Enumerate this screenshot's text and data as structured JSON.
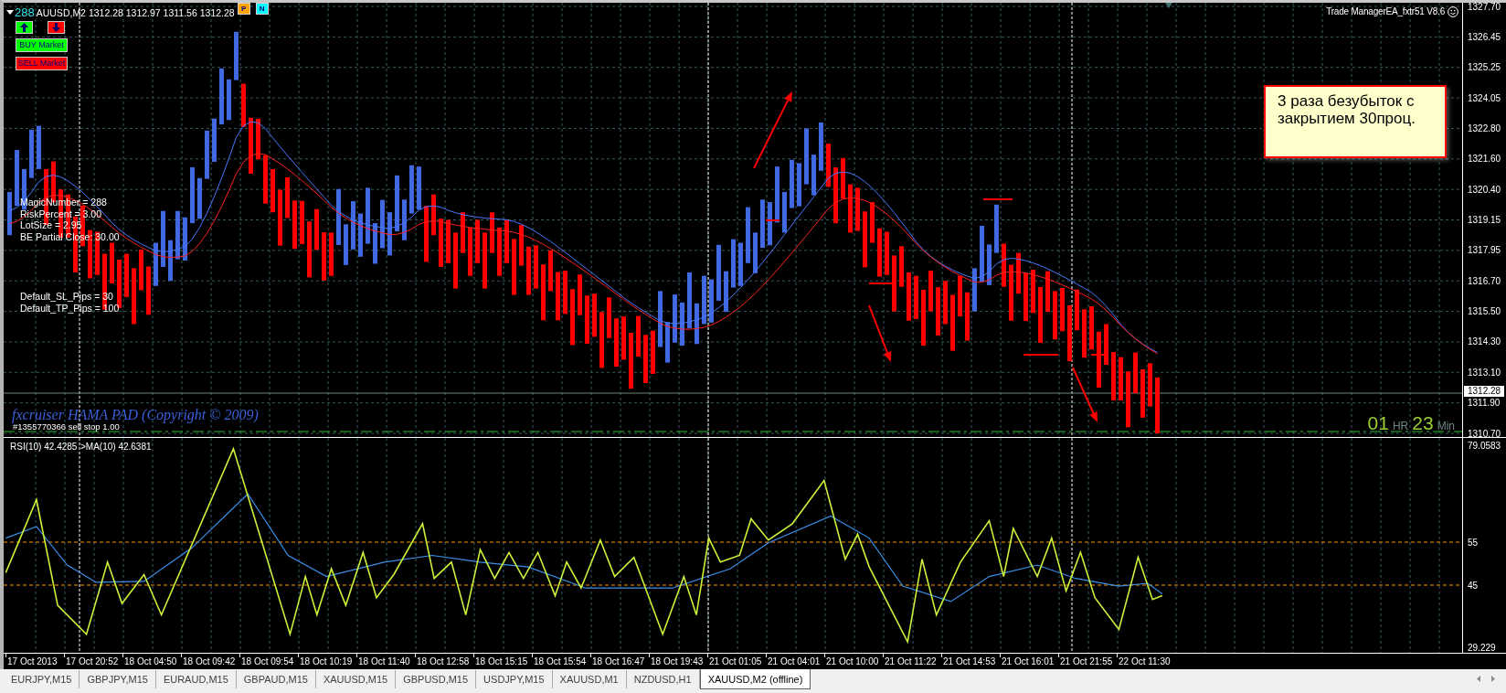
{
  "chart_window": {
    "header": {
      "magic_number": "288",
      "quote": "AUUSD,M2 1312.28 1312.97 1311.56 1312.28",
      "toggles": [
        {
          "label": "P",
          "kind": "p"
        },
        {
          "label": "N",
          "kind": "n"
        }
      ]
    },
    "market_buttons": [
      {
        "label": "BUY Market",
        "kind": "buy"
      },
      {
        "label": "SELL Market",
        "kind": "sell"
      }
    ],
    "ea_title": "Trade ManagerEA_fxtr51 V8.6",
    "settings": [
      "MagicNumber = 288",
      "RiskPercent = 3.00",
      "LotSize = 2.95",
      "BE Partial Close: 30.00"
    ],
    "defaults": [
      "Default_SL_Pips = 30",
      "Default_TP_Pips = 100"
    ],
    "note": "3 раза безубыток с закрытием 30проц.",
    "copyright": "fxcruiser HAMA PAD (Copyright © 2009)",
    "pending_order": "#1355770366 sell stop 1.00",
    "timer": {
      "hours": "01",
      "hours_unit": "HR",
      "minutes": "23",
      "minutes_unit": "Min"
    },
    "price_scale": {
      "ticks": [
        "1327.70",
        "1326.45",
        "1325.25",
        "1324.05",
        "1322.80",
        "1321.60",
        "1320.40",
        "1319.15",
        "1317.95",
        "1316.70",
        "1315.50",
        "1314.30",
        "1313.10",
        "1311.90",
        "1310.70"
      ],
      "current_price": "1312.28"
    }
  },
  "rsi_panel": {
    "rsi_label": "RSI(10) 42.4285",
    "ma_label": ">MA(10) 42.6381",
    "scale": [
      "79.0583",
      "55",
      "45",
      "29.229"
    ]
  },
  "time_axis": [
    "17 Oct 2013",
    "17 Oct 20:52",
    "18 Oct 04:50",
    "18 Oct 09:42",
    "18 Oct 09:54",
    "18 Oct 10:19",
    "18 Oct 11:40",
    "18 Oct 12:58",
    "18 Oct 15:15",
    "18 Oct 15:54",
    "18 Oct 16:47",
    "18 Oct 19:43",
    "21 Oct 01:05",
    "21 Oct 04:01",
    "21 Oct 10:00",
    "21 Oct 11:22",
    "21 Oct 14:53",
    "21 Oct 16:01",
    "21 Oct 21:55",
    "22 Oct 11:30"
  ],
  "tabs": [
    {
      "label": "EURJPY,M15",
      "selected": false
    },
    {
      "label": "GBPJPY,M15",
      "selected": false
    },
    {
      "label": "EURAUD,M15",
      "selected": false
    },
    {
      "label": "GBPAUD,M15",
      "selected": false
    },
    {
      "label": "XAUUSD,M15",
      "selected": false
    },
    {
      "label": "GBPUSD,M15",
      "selected": false
    },
    {
      "label": "USDJPY,M15",
      "selected": false
    },
    {
      "label": "XAUUSD,M1",
      "selected": false
    },
    {
      "label": "NZDUSD,H1",
      "selected": false
    },
    {
      "label": "XAUUSD,M2 (offline)",
      "selected": true
    }
  ]
}
